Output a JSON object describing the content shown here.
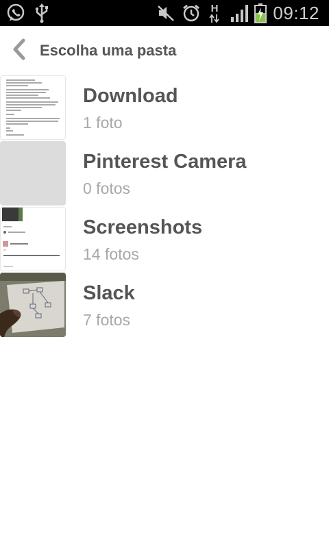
{
  "status_bar": {
    "time": "09:12",
    "network_type": "H",
    "icons": [
      "whatsapp-icon",
      "usb-icon",
      "mute-icon",
      "alarm-icon",
      "data-transfer-icon",
      "signal-icon",
      "battery-charging-icon"
    ],
    "battery_color": "#8bc34a"
  },
  "header": {
    "back_icon": "chevron-left-icon",
    "title": "Escolha uma pasta"
  },
  "folders": [
    {
      "name": "Download",
      "count": "1 foto",
      "thumbnail": "document-page"
    },
    {
      "name": "Pinterest Camera",
      "count": "0 fotos",
      "thumbnail": "empty-gray"
    },
    {
      "name": "Screenshots",
      "count": "14 fotos",
      "thumbnail": "screenshot-page"
    },
    {
      "name": "Slack",
      "count": "7 fotos",
      "thumbnail": "photo-whiteboard"
    }
  ],
  "colors": {
    "title_text": "#555555",
    "secondary_text": "#a8a8a8",
    "status_bar_bg": "#000000",
    "placeholder_thumb": "#dcdcdc"
  }
}
